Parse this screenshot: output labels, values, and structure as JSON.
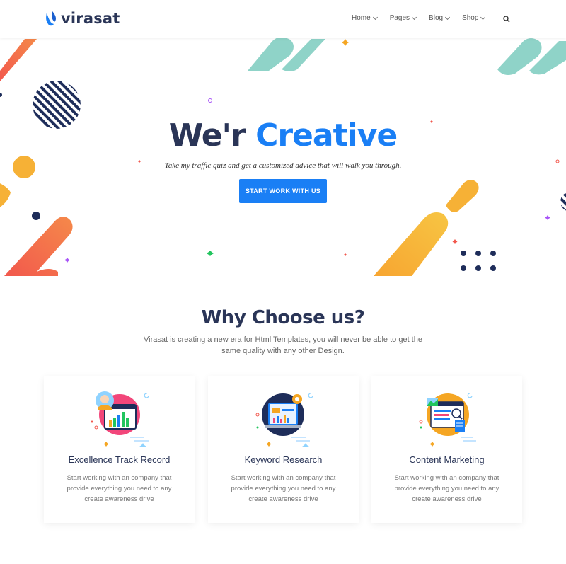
{
  "brand": {
    "name": "virasat",
    "color": "#1a7ff5",
    "dark": "#2a3557"
  },
  "nav": {
    "items": [
      {
        "label": "Home"
      },
      {
        "label": "Pages"
      },
      {
        "label": "Blog"
      },
      {
        "label": "Shop"
      }
    ],
    "search_icon": "search-icon"
  },
  "hero": {
    "title_part1": "We'r",
    "title_part2": "Creative",
    "subtitle": "Take my traffic quiz and get a customized advice that will walk you through.",
    "button_label": "START WORK WITH US"
  },
  "why": {
    "title": "Why Choose us?",
    "description": "Virasat is creating a new era for Html Templates, you will never be able to get the same quality with any other Design."
  },
  "features": [
    {
      "title": "Excellence Track Record",
      "text": "Start working with an company that provide everything you need to any create awareness drive",
      "icon": "chart-growth-icon"
    },
    {
      "title": "Keyword Research",
      "text": "Start working with an company that provide everything you need to any create awareness drive",
      "icon": "laptop-analytics-icon"
    },
    {
      "title": "Content Marketing",
      "text": "Start working with an company that provide everything you need to any create awareness drive",
      "icon": "content-browser-icon"
    }
  ],
  "colors": {
    "accent": "#1a7ff5",
    "orange": "#f5a623",
    "coral": "#f2584d",
    "teal": "#8fd3c8",
    "navy": "#1e2d5a"
  }
}
